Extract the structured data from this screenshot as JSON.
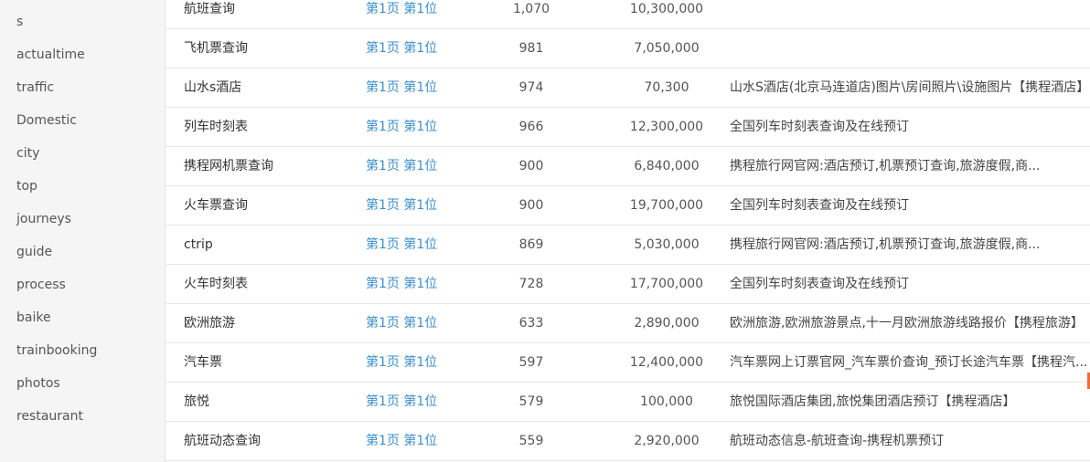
{
  "sidebar": {
    "items": [
      "s",
      "actualtime",
      "traffic",
      "Domestic",
      "city",
      "top",
      "journeys",
      "guide",
      "process",
      "baike",
      "trainbooking",
      "photos",
      "restaurant"
    ]
  },
  "rows": [
    {
      "keyword": "航班查询",
      "rank": "第1页 第1位",
      "index": "1,070",
      "volume": "10,300,000",
      "title": ""
    },
    {
      "keyword": "飞机票查询",
      "rank": "第1页 第1位",
      "index": "981",
      "volume": "7,050,000",
      "title": ""
    },
    {
      "keyword": "山水s酒店",
      "rank": "第1页 第1位",
      "index": "974",
      "volume": "70,300",
      "title": "山水S酒店(北京马连道店)图片\\房间照片\\设施图片【携程酒店】"
    },
    {
      "keyword": "列车时刻表",
      "rank": "第1页 第1位",
      "index": "966",
      "volume": "12,300,000",
      "title": "全国列车时刻表查询及在线预订"
    },
    {
      "keyword": "携程网机票查询",
      "rank": "第1页 第1位",
      "index": "900",
      "volume": "6,840,000",
      "title": "携程旅行网官网:酒店预订,机票预订查询,旅游度假,商..."
    },
    {
      "keyword": "火车票查询",
      "rank": "第1页 第1位",
      "index": "900",
      "volume": "19,700,000",
      "title": "全国列车时刻表查询及在线预订"
    },
    {
      "keyword": "ctrip",
      "rank": "第1页 第1位",
      "index": "869",
      "volume": "5,030,000",
      "title": "携程旅行网官网:酒店预订,机票预订查询,旅游度假,商..."
    },
    {
      "keyword": "火车时刻表",
      "rank": "第1页 第1位",
      "index": "728",
      "volume": "17,700,000",
      "title": "全国列车时刻表查询及在线预订"
    },
    {
      "keyword": "欧洲旅游",
      "rank": "第1页 第1位",
      "index": "633",
      "volume": "2,890,000",
      "title": "欧洲旅游,欧洲旅游景点,十一月欧洲旅游线路报价【携程旅游】"
    },
    {
      "keyword": "汽车票",
      "rank": "第1页 第1位",
      "index": "597",
      "volume": "12,400,000",
      "title": "汽车票网上订票官网_汽车票价查询_预订长途汽车票【携程汽..."
    },
    {
      "keyword": "旅悦",
      "rank": "第1页 第1位",
      "index": "579",
      "volume": "100,000",
      "title": "旅悦国际酒店集团,旅悦集团酒店预订【携程酒店】"
    },
    {
      "keyword": "航班动态查询",
      "rank": "第1页 第1位",
      "index": "559",
      "volume": "2,920,000",
      "title": "航班动态信息-航班查询-携程机票预订"
    }
  ]
}
